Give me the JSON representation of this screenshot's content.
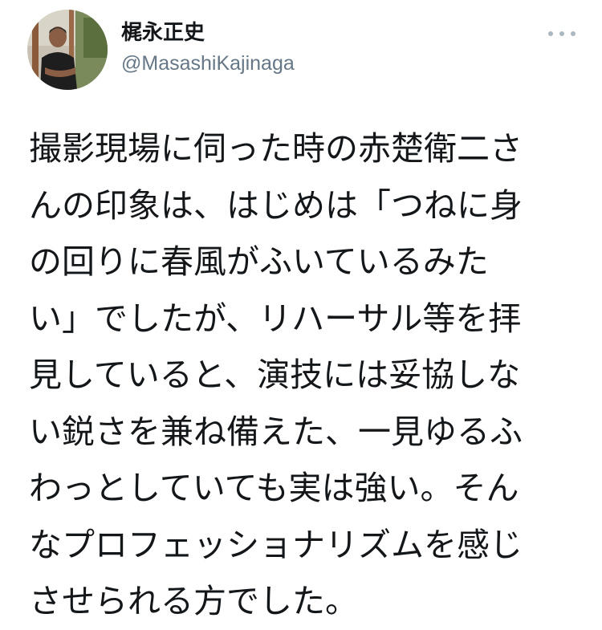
{
  "user": {
    "display_name": "梶永正史",
    "handle": "@MasashiKajinaga",
    "avatar_icon": "user-avatar-photo"
  },
  "menu": {
    "icon": "more-horizontal-icon"
  },
  "tweet": {
    "lines": [
      "撮影現場に伺った時の赤楚衛二さ",
      "んの印象は、はじめは「つねに身",
      "の回りに春風がふいているみた",
      "い」でしたが、リハーサル等を拝",
      "見していると、演技には妥協しな",
      "い鋭さを兼ね備えた、一見ゆるふ",
      "わっとしていても実は強い。そん",
      "なプロフェッショナリズムを感じ",
      "させられる方でした。"
    ]
  },
  "colors": {
    "text": "#14171a",
    "secondary": "#657786",
    "icon": "#aab8c2",
    "background": "#ffffff"
  }
}
